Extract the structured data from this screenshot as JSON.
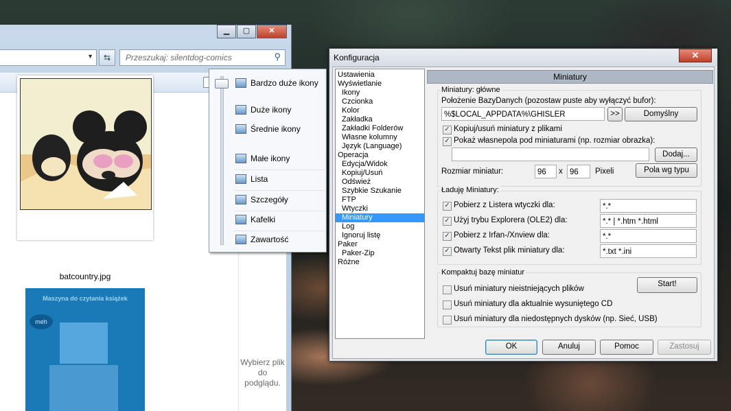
{
  "explorer": {
    "search_placeholder": "Przeszukaj: silentdog-comics",
    "refresh_icon": "⇆",
    "search_icon": "⚲",
    "file1_name": "batcountry.jpg",
    "file2_text": "Maszyna do czytania książek",
    "file2_bubble": "meh",
    "preview_text": "Wybierz plik do podglądu.",
    "title_buttons": {
      "minimize": "▁",
      "maximize": "▢",
      "close": "✕"
    }
  },
  "view_menu": {
    "items": [
      "Bardzo duże ikony",
      "Duże ikony",
      "Średnie ikony",
      "Małe ikony",
      "Lista",
      "Szczegóły",
      "Kafelki",
      "Zawartość"
    ]
  },
  "config": {
    "title": "Konfiguracja",
    "close_glyph": "✕",
    "tree": [
      {
        "label": "Ustawienia",
        "indent": 0
      },
      {
        "label": "Wyświetlanie",
        "indent": 0
      },
      {
        "label": "Ikony",
        "indent": 1
      },
      {
        "label": "Czcionka",
        "indent": 1
      },
      {
        "label": "Kolor",
        "indent": 1
      },
      {
        "label": "Zakładka",
        "indent": 1
      },
      {
        "label": "Zakładki Folderów",
        "indent": 1
      },
      {
        "label": "Własne kolumny",
        "indent": 1
      },
      {
        "label": "Język (Language)",
        "indent": 1
      },
      {
        "label": "Operacja",
        "indent": 0
      },
      {
        "label": "Edycja/Widok",
        "indent": 1
      },
      {
        "label": "Kopiuj/Usuń",
        "indent": 1
      },
      {
        "label": "Odśwież",
        "indent": 1
      },
      {
        "label": "Szybkie Szukanie",
        "indent": 1
      },
      {
        "label": "FTP",
        "indent": 1
      },
      {
        "label": "Wtyczki",
        "indent": 1
      },
      {
        "label": "Miniatury",
        "indent": 1,
        "selected": true
      },
      {
        "label": "Log",
        "indent": 1
      },
      {
        "label": "Ignoruj listę",
        "indent": 1
      },
      {
        "label": "Paker",
        "indent": 0
      },
      {
        "label": "Paker-Zip",
        "indent": 1
      },
      {
        "label": "Różne",
        "indent": 0
      }
    ],
    "panel_title": "Miniatury",
    "group1": {
      "legend": "Miniatury: główne",
      "location_label": "Położenie BazyDanych (pozostaw puste aby wyłączyć bufor):",
      "location_value": "%$LOCAL_APPDATA%\\GHISLER",
      "browse_btn": ">>",
      "default_btn": "Domyślny",
      "cb_copy": "Kopiuj/usuń miniatury z plikami",
      "cb_copy_checked": true,
      "cb_custom": "Pokaż własnepola pod miniaturami (np. rozmiar obrazka):",
      "cb_custom_checked": true,
      "custom_value": "",
      "add_btn": "Dodaj...",
      "size_label": "Rozmiar miniatur:",
      "width": "96",
      "x": "x",
      "height": "96",
      "unit": "Pixeli",
      "fields_btn": "Pola wg typu"
    },
    "group2": {
      "legend": "Ładuję Miniatury:",
      "rows": [
        {
          "label": "Pobierz z Listera wtyczki dla:",
          "value": "*.*",
          "checked": true
        },
        {
          "label": "Użyj trybu Explorera (OLE2) dla:",
          "value": "*.* | *.htm *.html",
          "checked": true
        },
        {
          "label": "Pobierz z Irfan-/Xnview dla:",
          "value": "*.*",
          "checked": true
        },
        {
          "label": "Otwarty Tekst plik miniatury dla:",
          "value": "*.txt *.ini",
          "checked": true
        }
      ]
    },
    "group3": {
      "legend": "Kompaktuj bazę miniatur",
      "start_btn": "Start!",
      "rows": [
        {
          "label": "Usuń miniatury nieistniejących plików",
          "checked": false
        },
        {
          "label": "Usuń miniatury dla aktualnie wysuniętego CD",
          "checked": false
        },
        {
          "label": "Usuń miniatury dla niedostępnych dysków (np. Sieć, USB)",
          "checked": false
        }
      ]
    },
    "buttons": {
      "ok": "OK",
      "cancel": "Anuluj",
      "help": "Pomoc",
      "apply": "Zastosuj"
    },
    "check_glyph": "✓"
  }
}
